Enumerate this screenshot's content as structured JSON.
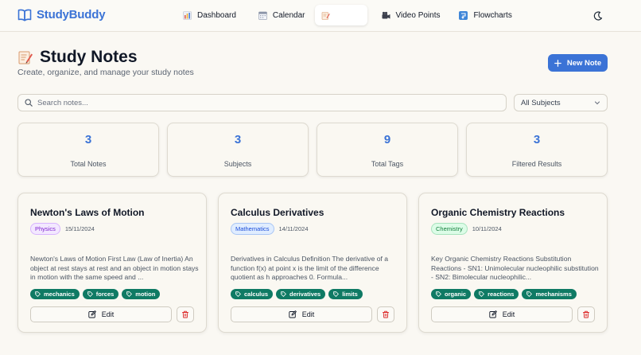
{
  "brand": {
    "name": "StudyBuddy",
    "color": "#3b73d6"
  },
  "nav": {
    "items": [
      {
        "label": "Dashboard",
        "icon": "bar-chart-icon"
      },
      {
        "label": "Calendar",
        "icon": "calendar-icon"
      },
      {
        "label": "",
        "icon": "memo-icon",
        "active": true
      },
      {
        "label": "Video Points",
        "icon": "video-camera-icon"
      },
      {
        "label": "Flowcharts",
        "icon": "flowchart-icon"
      }
    ],
    "theme_icon": "moon-icon"
  },
  "header": {
    "title": "Study Notes",
    "title_icon": "memo-icon",
    "subtitle": "Create, organize, and manage your study notes",
    "new_note_label": "New Note"
  },
  "filters": {
    "search_placeholder": "Search notes...",
    "subject_selected": "All Subjects"
  },
  "stats": [
    {
      "value": "3",
      "label": "Total Notes"
    },
    {
      "value": "3",
      "label": "Subjects"
    },
    {
      "value": "9",
      "label": "Total Tags"
    },
    {
      "value": "3",
      "label": "Filtered Results"
    }
  ],
  "notes": [
    {
      "title": "Newton's Laws of Motion",
      "subject": "Physics",
      "date": "15/11/2024",
      "excerpt": "Newton's Laws of Motion First Law (Law of Inertia) An object at rest stays at rest and an object in motion stays in motion with the same speed and ...",
      "tags": [
        "mechanics",
        "forces",
        "motion"
      ],
      "edit_label": "Edit"
    },
    {
      "title": "Calculus Derivatives",
      "subject": "Mathematics",
      "date": "14/11/2024",
      "excerpt": "Derivatives in Calculus Definition The derivative of a function f(x) at point x is the limit of the difference quotient as h approaches 0. Formula...",
      "tags": [
        "calculus",
        "derivatives",
        "limits"
      ],
      "edit_label": "Edit"
    },
    {
      "title": "Organic Chemistry Reactions",
      "subject": "Chemistry",
      "date": "10/11/2024",
      "excerpt": "Key Organic Chemistry Reactions Substitution Reactions - SN1: Unimolecular nucleophilic substitution - SN2: Bimolecular nucleophilic...",
      "tags": [
        "organic",
        "reactions",
        "mechanisms"
      ],
      "edit_label": "Edit"
    }
  ],
  "colors": {
    "accent": "#3b73d6",
    "tag": "#0f7a64",
    "delete": "#dc2626",
    "physics": "#7e22ce",
    "mathematics": "#1d4ed8",
    "chemistry": "#15803d"
  }
}
